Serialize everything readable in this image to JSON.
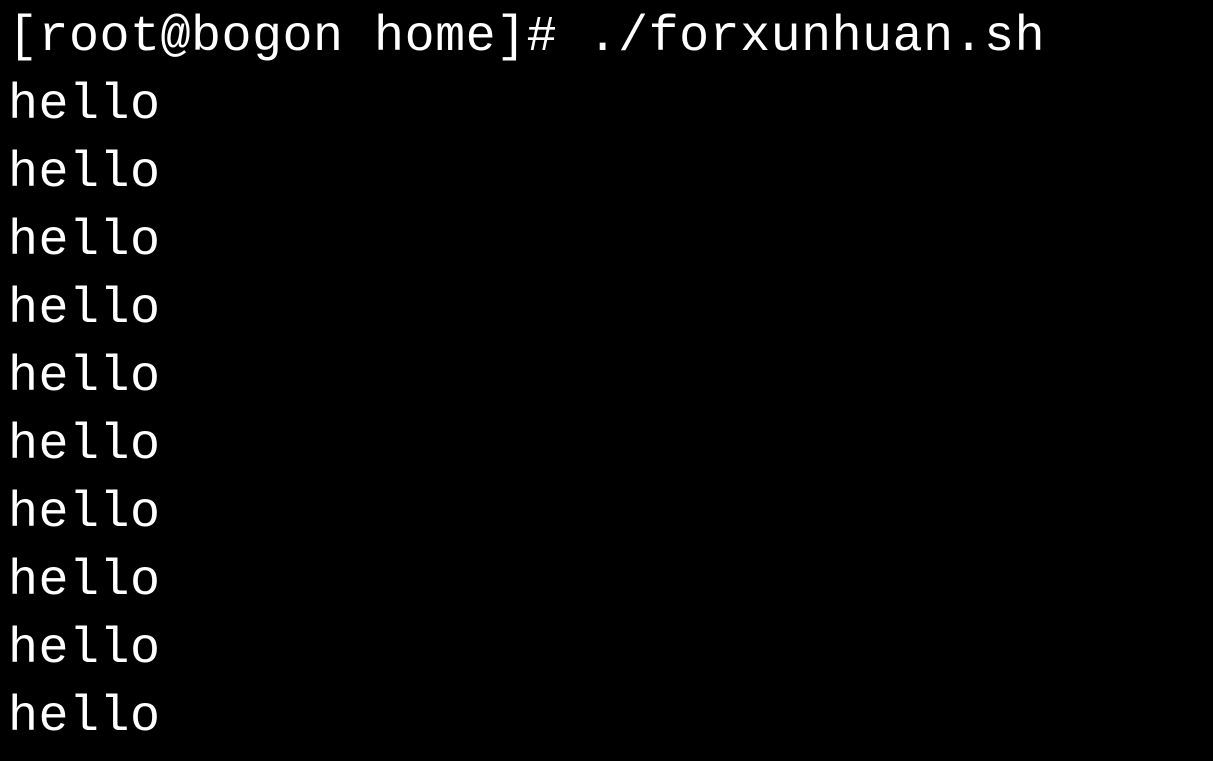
{
  "terminal": {
    "prompt": "[root@bogon home]# ",
    "command": "./forxunhuan.sh",
    "output_lines": [
      "hello",
      "hello",
      "hello",
      "hello",
      "hello",
      "hello",
      "hello",
      "hello",
      "hello",
      "hello"
    ]
  }
}
